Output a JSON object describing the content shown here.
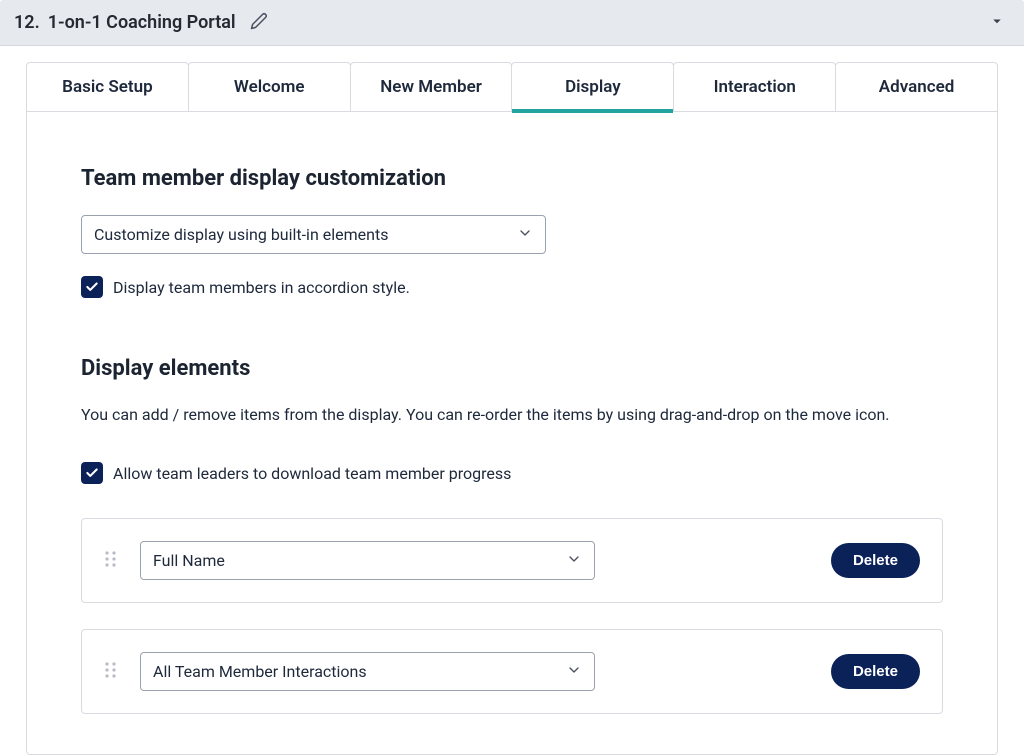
{
  "header": {
    "index": "12.",
    "title": "1-on-1 Coaching Portal"
  },
  "tabs": {
    "basic_setup": "Basic Setup",
    "welcome": "Welcome",
    "new_member": "New Member",
    "display": "Display",
    "interaction": "Interaction",
    "advanced": "Advanced",
    "active": "display"
  },
  "section1": {
    "title": "Team member display customization",
    "select_value": "Customize display using built-in elements",
    "checkbox_label": "Display team members in accordion style.",
    "checkbox_checked": true
  },
  "section2": {
    "title": "Display elements",
    "description": "You can add / remove items from the display. You can re-order the items by using drag-and-drop on the move icon.",
    "checkbox_label": "Allow team leaders to download team member progress",
    "checkbox_checked": true
  },
  "elements": [
    {
      "value": "Full Name",
      "delete_label": "Delete"
    },
    {
      "value": "All Team Member Interactions",
      "delete_label": "Delete"
    }
  ]
}
